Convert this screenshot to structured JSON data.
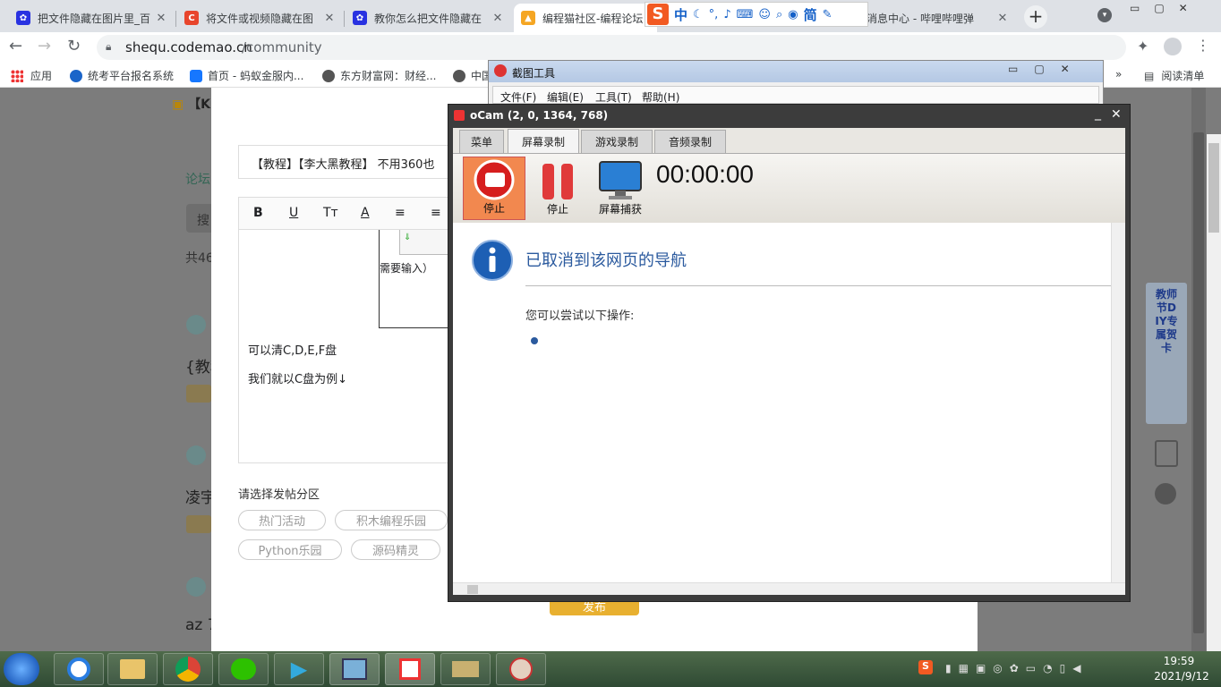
{
  "browser": {
    "tabs": [
      {
        "title": "把文件隐藏在图片里_百",
        "icon_color": "#2932e1"
      },
      {
        "title": "将文件或视频隐藏在图",
        "icon_color": "#e8452c"
      },
      {
        "title": "教你怎么把文件隐藏在",
        "icon_color": "#2932e1"
      },
      {
        "title": "编程猫社区-编程论坛",
        "icon_color": "#f5a623"
      },
      {
        "title": "消息中心 - 哔哩哔哩弹",
        "icon_color": "#00a1d6"
      }
    ],
    "url_host": "shequ.codemao.cn",
    "url_path": "/community",
    "bookmarks": [
      {
        "label": "应用"
      },
      {
        "label": "统考平台报名系统"
      },
      {
        "label": "首页 - 蚂蚁金服内..."
      },
      {
        "label": "东方财富网：财经..."
      },
      {
        "label": "中国"
      }
    ],
    "reading_list": "阅读清单",
    "more": "»"
  },
  "ime": {
    "logo": "S",
    "items": [
      "中",
      "简"
    ]
  },
  "page": {
    "title_input": "【教程】【李大黑教程】 不用360也",
    "left_title_char": "【K",
    "side_labels": [
      "论坛",
      "搜",
      "共46"
    ],
    "side_posts": [
      "{教程",
      "凌宇",
      "az 7"
    ],
    "editor_tools": [
      "B",
      "U",
      "Tт",
      "A"
    ],
    "editor_lines": [
      "可以清C,D,E,F盘",
      "我们就以C盘为例↓"
    ],
    "inner_fragment": "需要输入）",
    "section_label": "请选择发帖分区",
    "sections": [
      "热门活动",
      "积木编程乐园",
      "Python乐园",
      "源码精灵"
    ],
    "publish": "发布"
  },
  "jietu": {
    "title": "截图工具",
    "menu": [
      "文件(F)",
      "编辑(E)",
      "工具(T)",
      "帮助(H)"
    ]
  },
  "ocam": {
    "title": "oCam (2, 0, 1364, 768)",
    "tabs": [
      "菜单",
      "屏幕录制",
      "游戏录制",
      "音频录制"
    ],
    "buttons": [
      "停止",
      "停止",
      "屏幕捕获"
    ],
    "timer": "00:00:00",
    "heading": "已取消到该网页的导航",
    "subtext": "您可以尝试以下操作:"
  },
  "banner": {
    "text": "教师节DIY专属贺卡"
  },
  "tray": {
    "time": "19:59",
    "date": "2021/9/12"
  }
}
